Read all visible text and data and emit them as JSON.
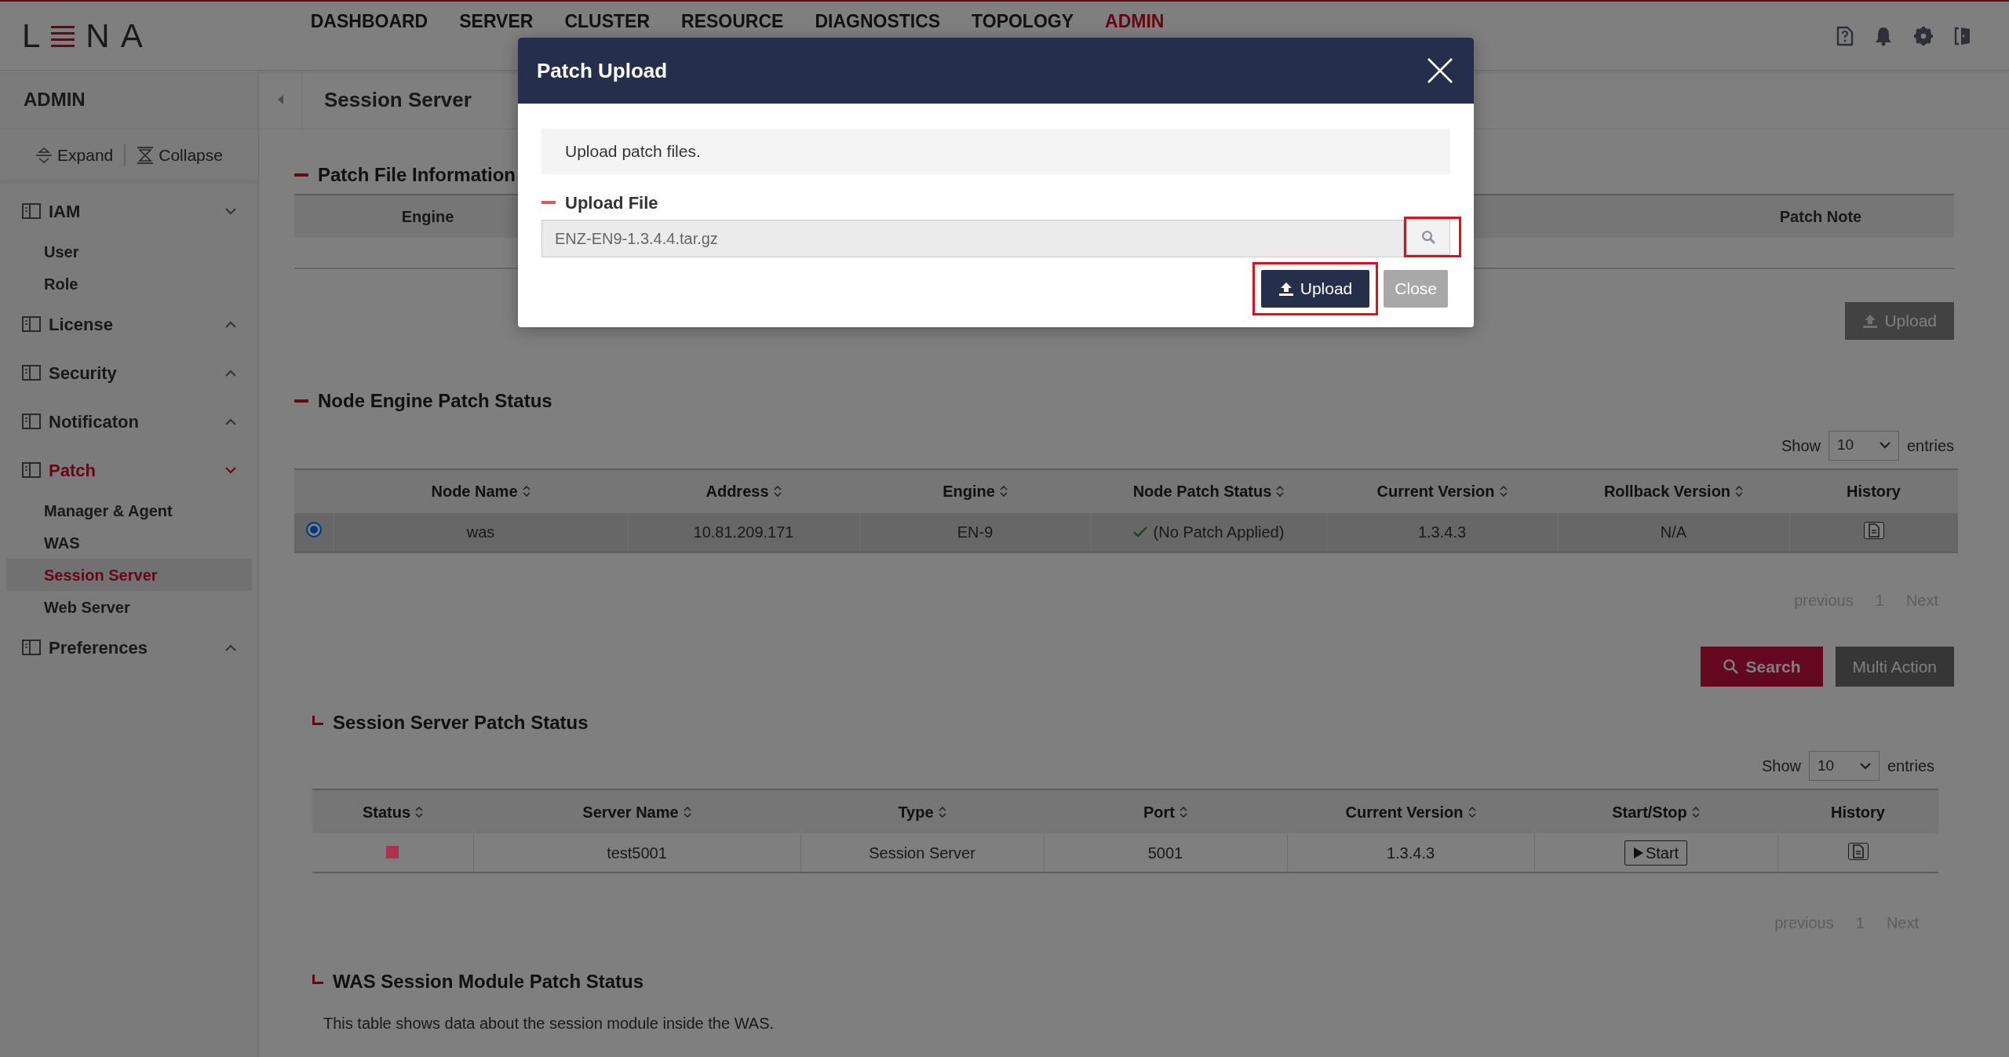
{
  "top_nav": {
    "logo": {
      "left": "L",
      "right": "NA"
    },
    "items": [
      {
        "label": "DASHBOARD",
        "selected": false
      },
      {
        "label": "SERVER",
        "selected": false
      },
      {
        "label": "CLUSTER",
        "selected": false
      },
      {
        "label": "RESOURCE",
        "selected": false
      },
      {
        "label": "DIAGNOSTICS",
        "selected": false
      },
      {
        "label": "TOPOLOGY",
        "selected": false
      },
      {
        "label": "ADMIN",
        "selected": true
      }
    ]
  },
  "sidebar": {
    "title": "ADMIN",
    "expand": "Expand",
    "collapse": "Collapse",
    "groups": [
      {
        "label": "IAM",
        "expanded": true,
        "selected": false,
        "children": [
          {
            "label": "User",
            "selected": false
          },
          {
            "label": "Role",
            "selected": false
          }
        ]
      },
      {
        "label": "License",
        "expanded": false,
        "selected": false
      },
      {
        "label": "Security",
        "expanded": false,
        "selected": false
      },
      {
        "label": "Notificaton",
        "expanded": false,
        "selected": false
      },
      {
        "label": "Patch",
        "expanded": true,
        "selected": true,
        "children": [
          {
            "label": "Manager & Agent",
            "selected": false
          },
          {
            "label": "WAS",
            "selected": false
          },
          {
            "label": "Session Server",
            "selected": true
          },
          {
            "label": "Web Server",
            "selected": false
          }
        ]
      },
      {
        "label": "Preferences",
        "expanded": false,
        "selected": false
      }
    ]
  },
  "page": {
    "title": "Session Server"
  },
  "patch_file_info": {
    "title": "Patch File Information",
    "columns": [
      "Engine",
      "Patch Note"
    ],
    "upload_button": {
      "label": "Upload",
      "disabled": true
    }
  },
  "node_table": {
    "title": "Node Engine Patch Status",
    "show_label": "Show",
    "page_size": "10",
    "entries_label": "entries",
    "columns": [
      {
        "label": "Node Name",
        "sortable": true
      },
      {
        "label": "Address",
        "sortable": true
      },
      {
        "label": "Engine",
        "sortable": true
      },
      {
        "label": "Node Patch Status",
        "sortable": true
      },
      {
        "label": "Current Version",
        "sortable": true
      },
      {
        "label": "Rollback Version",
        "sortable": true
      },
      {
        "label": "History",
        "sortable": false
      }
    ],
    "rows": [
      {
        "selected": true,
        "node_name": "was",
        "address": "10.81.209.171",
        "engine": "EN-9",
        "patch_status": "(No Patch Applied)",
        "current_version": "1.3.4.3",
        "rollback_version": "N/A"
      }
    ],
    "pagination": {
      "previous": "previous",
      "page": "1",
      "next": "Next"
    }
  },
  "actions": [
    {
      "label": "Search",
      "kind": "primary"
    },
    {
      "label": "Multi Action",
      "kind": "secondary"
    }
  ],
  "session_table": {
    "title": "Session Server Patch Status",
    "show_label": "Show",
    "page_size": "10",
    "entries_label": "entries",
    "columns": [
      {
        "label": "Status",
        "sortable": true
      },
      {
        "label": "Server Name",
        "sortable": true
      },
      {
        "label": "Type",
        "sortable": true
      },
      {
        "label": "Port",
        "sortable": true
      },
      {
        "label": "Current Version",
        "sortable": true
      },
      {
        "label": "Start/Stop",
        "sortable": true
      },
      {
        "label": "History",
        "sortable": false
      }
    ],
    "rows": [
      {
        "color": "#a8344e",
        "server_name": "test5001",
        "type": "Session Server",
        "port": "5001",
        "current_version": "1.3.4.3",
        "action": "Start"
      }
    ],
    "pagination": {
      "previous": "previous",
      "page": "1",
      "next": "Next"
    }
  },
  "was_section": {
    "title": "WAS Session Module Patch Status",
    "description": "This table shows data about the session module inside the WAS."
  },
  "modal": {
    "title": "Patch Upload",
    "info": "Upload patch files.",
    "field_label": "Upload File",
    "file_value": "ENZ-EN9-1.3.4.4.tar.gz",
    "search_highlighted": true,
    "buttons": [
      {
        "label": "Upload",
        "kind": "primary",
        "highlighted": true
      },
      {
        "label": "Close",
        "kind": "secondary",
        "highlighted": false
      }
    ]
  }
}
